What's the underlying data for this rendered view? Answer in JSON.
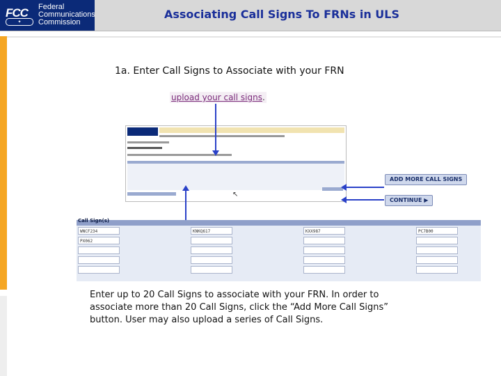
{
  "header": {
    "logo_mark": "FCC",
    "logo_name": [
      "Federal",
      "Communications",
      "Commission"
    ],
    "title": "Associating Call Signs To FRNs in ULS"
  },
  "main": {
    "step_title": "1a. Enter Call Signs to Associate with your FRN",
    "upload_link": "upload your call signs",
    "upload_suffix": "."
  },
  "buttons": {
    "add_more": "ADD MORE CALL SIGNS",
    "continue": "CONTINUE"
  },
  "grid": {
    "header": "Call Sign(s)",
    "cells": [
      "WNCF234",
      "KNKQ617",
      "KXX987",
      "PC7B00",
      "PX062"
    ]
  },
  "description": "Enter up to 20 Call Signs to associate with your FRN. In order to associate more than 20 Call Signs, click the “Add More Call Signs” button. User may also upload a series of Call Signs.",
  "colors": {
    "accent": "#1a2f9a",
    "left_bar": "#f5a623",
    "arrow": "#2a41c8"
  }
}
